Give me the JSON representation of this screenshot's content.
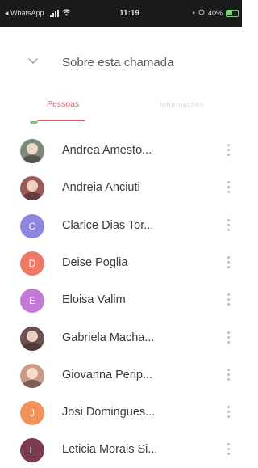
{
  "status_bar": {
    "back_app": "◂ WhatsApp",
    "time": "11:19",
    "battery_text": "40%"
  },
  "header": {
    "title": "Sobre esta chamada",
    "icon": "chevron-down-icon"
  },
  "tabs": {
    "active": "Pessoas",
    "inactive": "Informações"
  },
  "participants": [
    {
      "name": "Andrea Amesto...",
      "avatar_type": "photo",
      "avatar_color": "#7a8a7d",
      "initial": ""
    },
    {
      "name": "Andreia Anciuti",
      "avatar_type": "photo",
      "avatar_color": "#9a5a5a",
      "initial": ""
    },
    {
      "name": "Clarice Dias Tor...",
      "avatar_type": "initial",
      "avatar_color": "#8f86e0",
      "initial": "C"
    },
    {
      "name": "Deise Poglia",
      "avatar_type": "initial",
      "avatar_color": "#ef7866",
      "initial": "D"
    },
    {
      "name": "Eloisa Valim",
      "avatar_type": "initial",
      "avatar_color": "#c27ad6",
      "initial": "E"
    },
    {
      "name": "Gabriela Macha...",
      "avatar_type": "photo",
      "avatar_color": "#6a5050",
      "initial": ""
    },
    {
      "name": "Giovanna Perip...",
      "avatar_type": "photo",
      "avatar_color": "#c99c8a",
      "initial": ""
    },
    {
      "name": "Josi Domingues...",
      "avatar_type": "initial",
      "avatar_color": "#f0925a",
      "initial": "J"
    },
    {
      "name": "Leticia Morais Si...",
      "avatar_type": "initial",
      "avatar_color": "#7a3a50",
      "initial": "L"
    }
  ],
  "colors": {
    "accent": "#e0616e",
    "status_bar_bg": "#1a1a1a",
    "text": "#3a3a3a"
  }
}
